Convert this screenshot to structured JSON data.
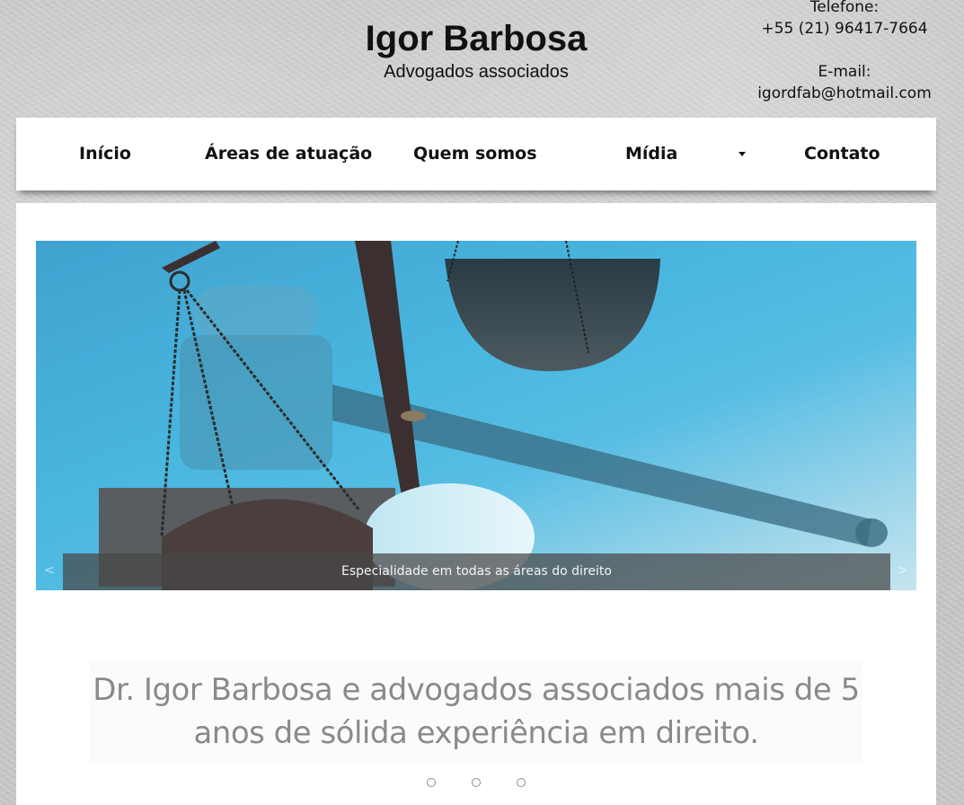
{
  "header": {
    "title": "Igor Barbosa",
    "subtitle": "Advogados associados",
    "phone_label": "Telefone:",
    "phone": "+55 (21) 96417-7664",
    "email_label": "E-mail:",
    "email": "igordfab@hotmail.com"
  },
  "nav": {
    "items": [
      "Início",
      "Áreas de atuação",
      "Quem somos",
      "Mídia",
      "Contato"
    ],
    "dropdown_item": "Mídia"
  },
  "slider": {
    "caption": "Especialidade em todas as áreas do direito",
    "prev": "<",
    "next": ">"
  },
  "tagline": {
    "line1": "Dr. Igor Barbosa e advogados associados mais de 5",
    "line2": "anos de sólida experiência em direito."
  },
  "pager": {
    "count": 3
  },
  "colors": {
    "slider_blue": "#49b7e0",
    "nav_background": "#ffffff",
    "tagline_text": "#8a8a8a"
  }
}
